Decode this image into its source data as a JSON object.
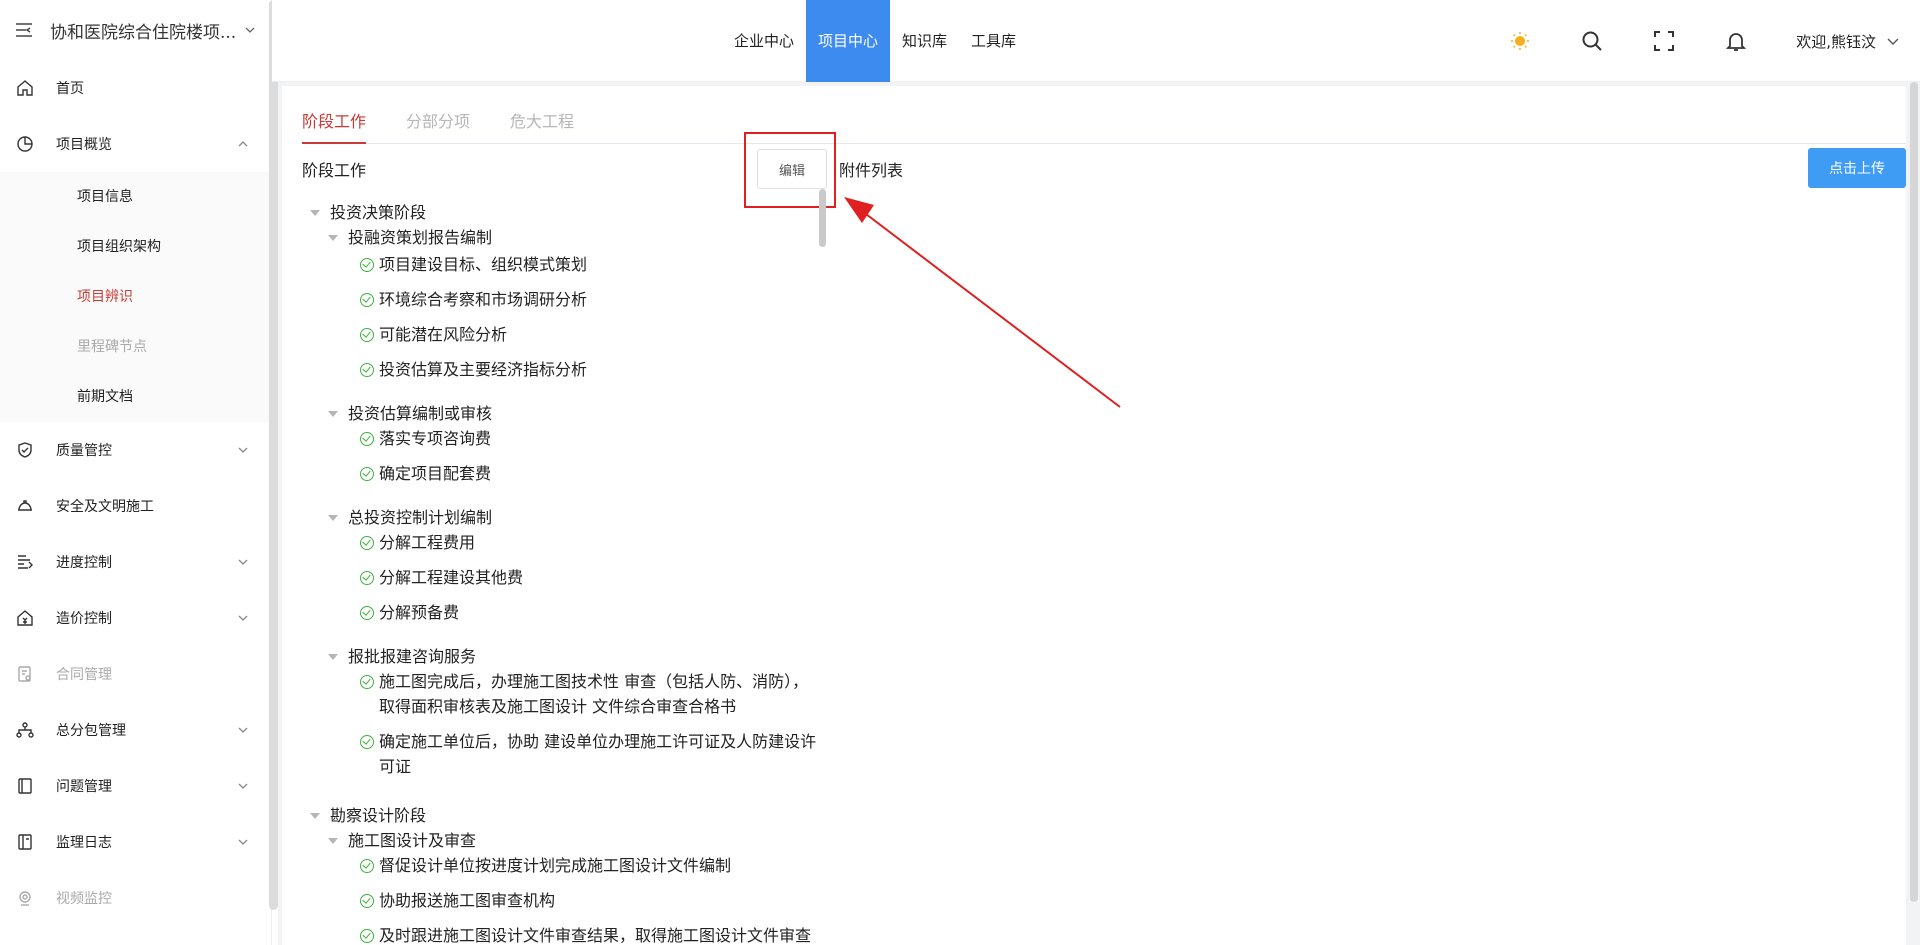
{
  "sidebar": {
    "project_title": "协和医院综合住院楼项...",
    "items": [
      {
        "label": "首页",
        "icon": "home-icon"
      },
      {
        "label": "项目概览",
        "icon": "pie-chart-icon"
      },
      {
        "label": "质量管控",
        "icon": "shield-check-icon"
      },
      {
        "label": "安全及文明施工",
        "icon": "helmet-icon"
      },
      {
        "label": "进度控制",
        "icon": "progress-icon"
      },
      {
        "label": "造价控制",
        "icon": "cost-icon"
      },
      {
        "label": "合同管理",
        "icon": "contract-icon"
      },
      {
        "label": "总分包管理",
        "icon": "org-tree-icon"
      },
      {
        "label": "问题管理",
        "icon": "issue-book-icon"
      },
      {
        "label": "监理日志",
        "icon": "log-book-icon"
      },
      {
        "label": "视频监控",
        "icon": "camera-icon"
      }
    ],
    "submenu": [
      {
        "label": "项目信息"
      },
      {
        "label": "项目组织架构"
      },
      {
        "label": "项目辨识"
      },
      {
        "label": "里程碑节点"
      },
      {
        "label": "前期文档"
      }
    ]
  },
  "topnav": {
    "items": [
      "企业中心",
      "项目中心",
      "知识库",
      "工具库"
    ],
    "active": "项目中心",
    "user": "欢迎,熊钰汶"
  },
  "tabs": [
    "阶段工作",
    "分部分项",
    "危大工程"
  ],
  "panel": {
    "left_title": "阶段工作",
    "edit_label": "编辑",
    "right_title": "附件列表",
    "upload_label": "点击上传"
  },
  "tree": {
    "stage1": "投资决策阶段",
    "g1": "投融资策划报告编制",
    "g1_items": [
      "项目建设目标、组织模式策划",
      "环境综合考察和市场调研分析",
      "可能潜在风险分析",
      "投资估算及主要经济指标分析"
    ],
    "g2": "投资估算编制或审核",
    "g2_items": [
      "落实专项咨询费",
      "确定项目配套费"
    ],
    "g3": "总投资控制计划编制",
    "g3_items": [
      "分解工程费用",
      "分解工程建设其他费",
      "分解预备费"
    ],
    "g4": "报批报建咨询服务",
    "g4_items": [
      "施工图完成后，办理施工图技术性 审查（包括人防、消防），取得面积审核表及施工图设计 文件综合审查合格书",
      "确定施工单位后，协助 建设单位办理施工许可证及人防建设许可证"
    ],
    "stage2": "勘察设计阶段",
    "g5": "施工图设计及审查",
    "g5_items": [
      "督促设计单位按进度计划完成施工图设计文件编制",
      "协助报送施工图审查机构",
      "及时跟进施工图设计文件审查结果，取得施工图设计文件审查"
    ]
  },
  "colors": {
    "accent_blue": "#3e8bf0",
    "active_red": "#c93b36",
    "check_green": "#3cb33c",
    "annotation_red": "#e02020"
  }
}
